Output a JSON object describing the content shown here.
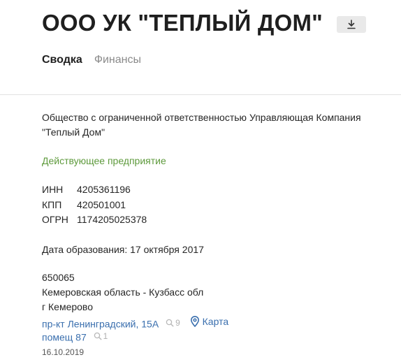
{
  "header": {
    "title": "ООО УК \"ТЕПЛЫЙ ДОМ\""
  },
  "tabs": [
    {
      "label": "Сводка",
      "active": true
    },
    {
      "label": "Финансы",
      "active": false
    }
  ],
  "company": {
    "full_name": "Общество с ограниченной ответственностью Управляющая Компания \"Теплый Дом\"",
    "status": "Действующее предприятие",
    "codes": [
      {
        "label": "ИНН",
        "value": "4205361196"
      },
      {
        "label": "КПП",
        "value": "420501001"
      },
      {
        "label": "ОГРН",
        "value": "1174205025378"
      }
    ],
    "founded": "Дата образования: 17 октября 2017",
    "address": {
      "postcode": "650065",
      "region": "Кемеровская область - Кузбасс обл",
      "city": "г Кемерово",
      "street": "пр-кт Ленинградский, 15А",
      "street_count": "9",
      "map_label": "Карта",
      "premises": "помещ 87",
      "premises_count": "1",
      "date": "16.10.2019"
    }
  },
  "colors": {
    "status": "#5e9a3c",
    "link": "#3a6fae",
    "button_bg": "#e9e9e9"
  },
  "icons": {
    "download": "download-icon",
    "search": "search-icon",
    "map": "map-pin-icon"
  }
}
